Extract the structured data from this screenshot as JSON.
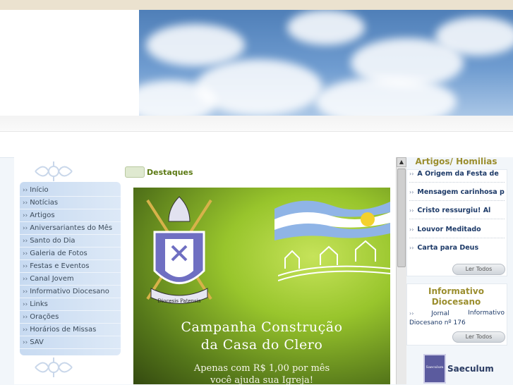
{
  "menu": {
    "items": [
      {
        "label": "Início"
      },
      {
        "label": "Notícias"
      },
      {
        "label": "Artigos"
      },
      {
        "label": "Aniversariantes do Mês"
      },
      {
        "label": "Santo do Dia"
      },
      {
        "label": "Galeria de Fotos"
      },
      {
        "label": "Festas e Eventos"
      },
      {
        "label": "Canal Jovem"
      },
      {
        "label": "Informativo Diocesano"
      },
      {
        "label": "Links"
      },
      {
        "label": "Orações"
      },
      {
        "label": "Horários de Missas"
      },
      {
        "label": "SAV"
      }
    ],
    "arrow": "››"
  },
  "destaques": {
    "title": "Destaques",
    "feature": {
      "seal_text": "Diocesis Patensis",
      "headline_line1": "Campanha Construção",
      "headline_line2": "da Casa do Clero",
      "subline1": "Apenas com R$ 1,00 por mês",
      "subline2": "você ajuda sua Igreja!"
    }
  },
  "artigos": {
    "title": "Artigos/ Homilias",
    "items": [
      "A Origem da Festa de",
      "Mensagem carinhosa p",
      "Cristo ressurgiu! Al",
      "Louvor Meditado",
      "Carta para Deus"
    ],
    "ler_todos": "Ler Todos"
  },
  "informativo": {
    "title_line1": "Informativo",
    "title_line2": "Diocesano",
    "text_a": "Jornal",
    "text_b": "Informativo",
    "text_c": "Diocesano nº 176",
    "ler_todos": "Ler Todos"
  },
  "saeculum": {
    "title": "Saeculum",
    "logo_text": "Saeculum"
  },
  "colors": {
    "accent_green": "#5c7a14",
    "accent_gold": "#9b8e2e",
    "link_blue": "#1d3a68",
    "menu_bg": "#c7daf1"
  }
}
